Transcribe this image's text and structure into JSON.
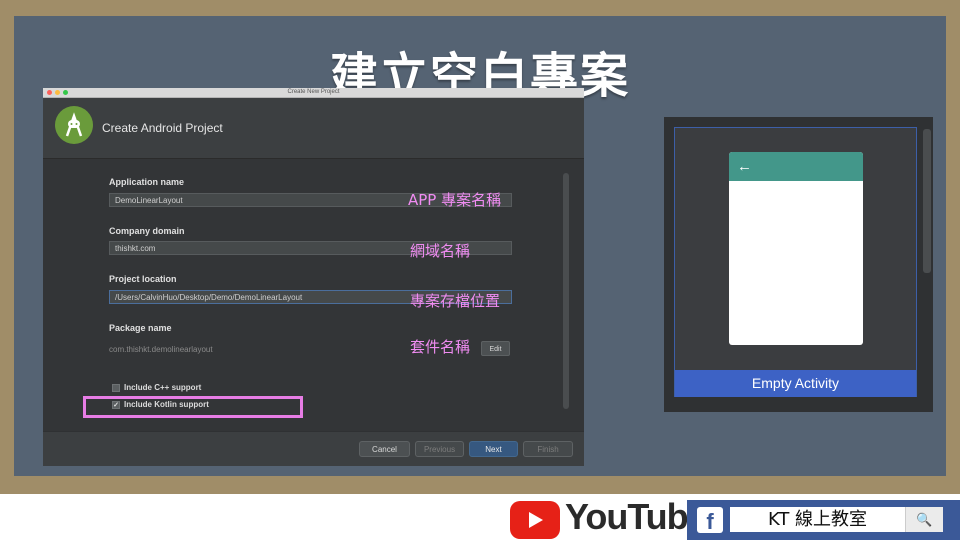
{
  "slide": {
    "title": "建立空白專案"
  },
  "dialog": {
    "window_title": "Create New Project",
    "header_title": "Create Android Project",
    "fields": [
      {
        "label": "Application name",
        "value": "DemoLinearLayout"
      },
      {
        "label": "Company domain",
        "value": "thishkt.com"
      },
      {
        "label": "Project location",
        "value": "/Users/CalvinHuo/Desktop/Demo/DemoLinearLayout"
      }
    ],
    "package": {
      "label": "Package name",
      "value": "com.thishkt.demolinearlayout",
      "edit_label": "Edit"
    },
    "checkboxes": [
      {
        "label": "Include C++ support",
        "checked": false
      },
      {
        "label": "Include Kotlin support",
        "checked": true
      }
    ],
    "buttons": {
      "cancel": "Cancel",
      "previous": "Previous",
      "next": "Next",
      "finish": "Finish"
    }
  },
  "annotations": {
    "app_name": "APP 專案名稱",
    "domain": "網域名稱",
    "location": "專案存檔位置",
    "package": "套件名稱"
  },
  "preview": {
    "activity_label": "Empty Activity",
    "back_arrow": "←"
  },
  "footer": {
    "youtube_text": "YouTube",
    "facebook_icon_text": "f",
    "facebook_search_text": "KT 線上教室",
    "search_icon": "magnifier-icon",
    "search_glyph": "🔍"
  },
  "colors": {
    "frame": "#a08d68",
    "board": "#556373",
    "annotation": "#f08cf2",
    "appbar": "#43978a",
    "activity_label_bg": "#3d62c5",
    "youtube_red": "#e62117",
    "facebook_blue": "#3b5998"
  }
}
